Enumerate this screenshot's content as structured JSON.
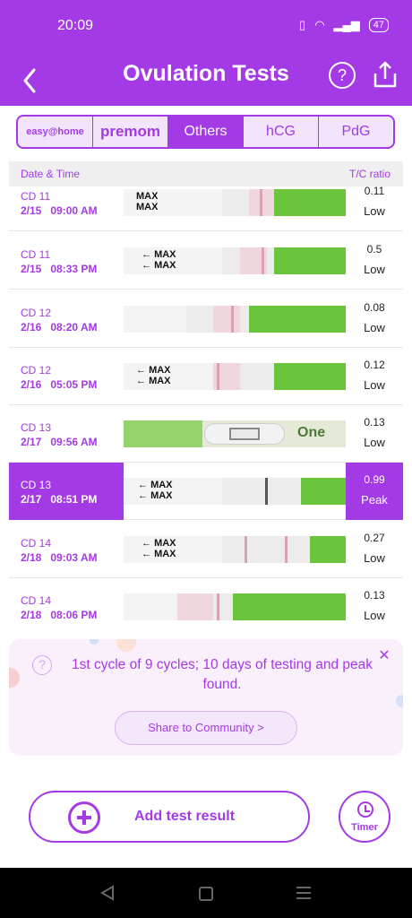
{
  "status_bar": {
    "time": "20:09",
    "battery": "47"
  },
  "header": {
    "title": "Ovulation Tests"
  },
  "brand_tabs": [
    {
      "label": "easy@home",
      "active": false
    },
    {
      "label": "premom",
      "active": false
    },
    {
      "label": "Others",
      "active": true
    },
    {
      "label": "hCG",
      "active": false
    },
    {
      "label": "PdG",
      "active": false
    }
  ],
  "list_header": {
    "left": "Date & Time",
    "right": "T/C ratio"
  },
  "rows": [
    {
      "cd": "CD 11",
      "date": "2/15   09:00 AM",
      "ratio": "0.11",
      "level": "Low",
      "highlight": false
    },
    {
      "cd": "CD 11",
      "date": "2/15   08:33 PM",
      "ratio": "0.5",
      "level": "Low",
      "highlight": false
    },
    {
      "cd": "CD 12",
      "date": "2/16   08:20 AM",
      "ratio": "0.08",
      "level": "Low",
      "highlight": false
    },
    {
      "cd": "CD 12",
      "date": "2/16   05:05 PM",
      "ratio": "0.12",
      "level": "Low",
      "highlight": false
    },
    {
      "cd": "CD 13",
      "date": "2/17   09:56 AM",
      "ratio": "0.13",
      "level": "Low",
      "highlight": false
    },
    {
      "cd": "CD 13",
      "date": "2/17   08:51 PM",
      "ratio": "0.99",
      "level": "Peak",
      "highlight": true
    },
    {
      "cd": "CD 14",
      "date": "2/18   09:03 AM",
      "ratio": "0.27",
      "level": "Low",
      "highlight": false
    },
    {
      "cd": "CD 14",
      "date": "2/18   08:06 PM",
      "ratio": "0.13",
      "level": "Low",
      "highlight": false
    }
  ],
  "strip_text": {
    "max": "MAX"
  },
  "summary": {
    "text": "1st cycle of 9 cycles; 10 days of testing and peak found.",
    "share_button": "Share to Community   >"
  },
  "actions": {
    "add_label": "Add test result",
    "timer_label": "Timer"
  },
  "colors": {
    "accent": "#a43ae6",
    "green": "#6ac53d"
  }
}
